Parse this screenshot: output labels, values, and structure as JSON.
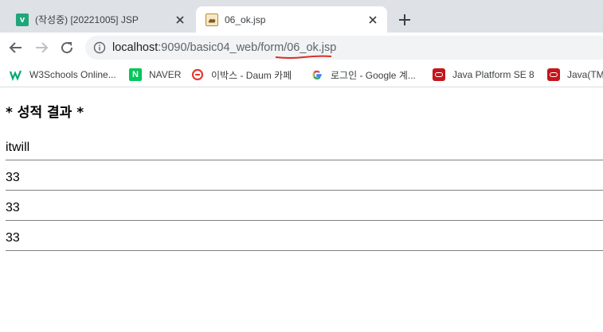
{
  "browser": {
    "tabs": [
      {
        "title": "(작성중) [20221005] JSP",
        "favicon": "v-logo-icon",
        "active": false
      },
      {
        "title": "06_ok.jsp",
        "favicon": "tomcat-icon",
        "active": true
      }
    ],
    "new_tab_icon": "plus-icon",
    "address_bar": {
      "host": "localhost",
      "path": ":9090/basic04_web/form/06_ok.jsp"
    },
    "bookmarks": [
      {
        "label": "W3Schools Online...",
        "icon": "w3schools-icon"
      },
      {
        "label": "NAVER",
        "icon": "naver-icon",
        "icon_text": "N"
      },
      {
        "label": "이박스 - Daum 카페",
        "icon": "daum-cafe-icon"
      },
      {
        "label": "로그인 - Google 계...",
        "icon": "google-icon"
      },
      {
        "label": "Java Platform SE 8",
        "icon": "oracle-icon"
      },
      {
        "label": "Java(TM",
        "icon": "oracle-icon"
      }
    ]
  },
  "page": {
    "title": "* 성적 결과 *",
    "results": [
      "itwill",
      "33",
      "33",
      "33"
    ]
  },
  "colors": {
    "tab_strip": "#dee1e6",
    "omnibox": "#f1f3f4",
    "annotation_red": "#d93025",
    "rule": "#808080"
  }
}
